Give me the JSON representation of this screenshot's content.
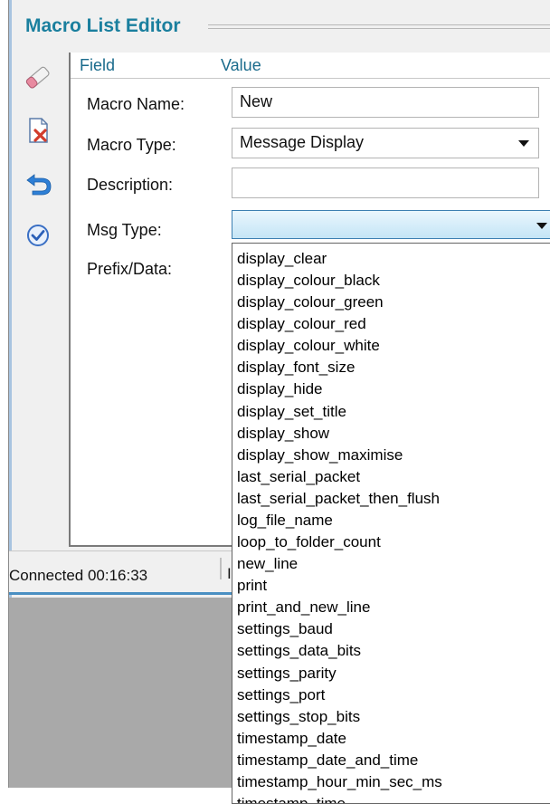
{
  "editor": {
    "title": "Macro List Editor",
    "columns": {
      "field": "Field",
      "value": "Value"
    },
    "toolbar": [
      {
        "icon": "eraser-icon"
      },
      {
        "icon": "delete-document-icon"
      },
      {
        "icon": "undo-icon"
      },
      {
        "icon": "check-icon"
      }
    ],
    "fields": {
      "macro_name_label": "Macro Name:",
      "macro_name_value": "New",
      "macro_type_label": "Macro Type:",
      "macro_type_value": "Message Display",
      "description_label": "Description:",
      "description_value": "",
      "msg_type_label": "Msg Type:",
      "msg_type_value": "",
      "prefix_label": "Prefix/Data:"
    },
    "msg_type_options": [
      "display_clear",
      "display_colour_black",
      "display_colour_green",
      "display_colour_red",
      "display_colour_white",
      "display_font_size",
      "display_hide",
      "display_set_title",
      "display_show",
      "display_show_maximise",
      "last_serial_packet",
      "last_serial_packet_then_flush",
      "log_file_name",
      "loop_to_folder_count",
      "new_line",
      "print",
      "print_and_new_line",
      "settings_baud",
      "settings_data_bits",
      "settings_parity",
      "settings_port",
      "settings_stop_bits",
      "timestamp_date",
      "timestamp_date_and_time",
      "timestamp_hour_min_sec_ms",
      "timestamp_time"
    ]
  },
  "status": {
    "connection": "Connected 00:16:33",
    "second_panel": "I"
  },
  "colors": {
    "accent": "#1a7f9e",
    "selection": "#c4e5f6",
    "panel": "#f0f0f0",
    "desktop": "#a9a9a9"
  }
}
